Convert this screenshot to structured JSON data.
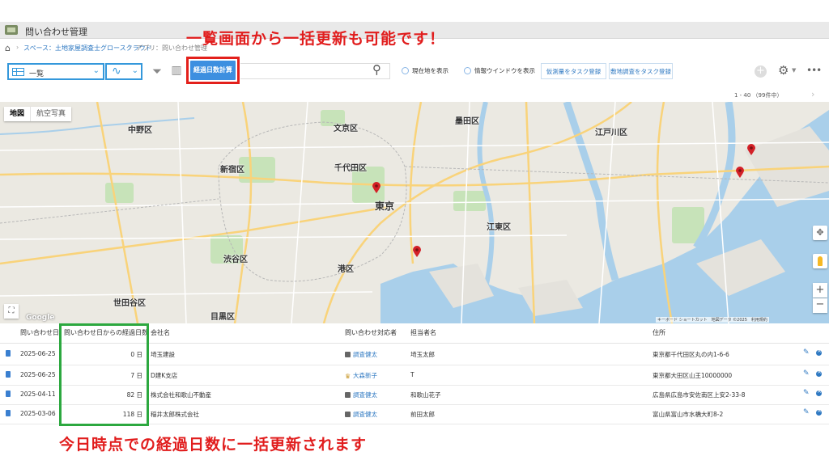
{
  "app": {
    "title": "問い合わせ管理"
  },
  "breadcrumb": {
    "space": "スペース：土地家屋調査士グロースクラウド",
    "app": "アプリ：問い合わせ管理"
  },
  "annotations": {
    "top": "一覧画面から一括更新も可能です！",
    "bottom": "今日時点での経過日数に一括更新されます"
  },
  "toolbar": {
    "view_label": "一覧",
    "calc_button": "経過日数計算",
    "search_value": "",
    "radio_current": "現在地を表示",
    "radio_info": "情報ウインドウを表示",
    "task_button_1": "仮測量をタスク登録",
    "task_button_2": "敷地調査をタスク登録"
  },
  "pager": {
    "text": "1 - 40 （99件中）"
  },
  "map": {
    "tab_map": "地図",
    "tab_aerial": "航空写真",
    "google": "Google",
    "attribution": "キーボード ショートカット　地図データ ©2025　利用規約",
    "labels": {
      "nakano": "中野区",
      "bunkyo": "文京区",
      "sumida": "墨田区",
      "edogawa": "江戸川区",
      "shinjuku": "新宿区",
      "chiyoda": "千代田区",
      "tokyo": "東京",
      "koto": "江東区",
      "shibuya": "渋谷区",
      "minato": "港区",
      "setagaya": "世田谷区",
      "meguro": "目黒区"
    }
  },
  "table": {
    "headers": {
      "date": "問い合わせ日",
      "days": "問い合わせ日からの経過日数",
      "company": "会社名",
      "handler": "問い合わせ対応者",
      "contact": "担当者名",
      "address": "住所"
    },
    "rows": [
      {
        "date": "2025-06-25",
        "days": "0 日",
        "company": "埼玉建設",
        "handler": "調査健太",
        "contact": "埼玉太郎",
        "address": "東京都千代田区丸の内1-6-6"
      },
      {
        "date": "2025-06-25",
        "days": "7 日",
        "company": "D建K支店",
        "handler": "大森新子",
        "contact": "T",
        "address": "東京都大田区山王10000000"
      },
      {
        "date": "2025-04-11",
        "days": "82 日",
        "company": "株式会社和歌山不動産",
        "handler": "調査健太",
        "contact": "和歌山花子",
        "address": "広島県広島市安佐南区上安2-33-8"
      },
      {
        "date": "2025-03-06",
        "days": "118 日",
        "company": "稲井太郎株式会社",
        "handler": "調査健太",
        "contact": "前田太郎",
        "address": "富山県富山市水橋大町8-2"
      }
    ]
  },
  "colors": {
    "accent": "#3d8fe0",
    "annotation_red": "#e11d1d",
    "annotation_green": "#2ca83f",
    "pin_red": "#d32027"
  }
}
